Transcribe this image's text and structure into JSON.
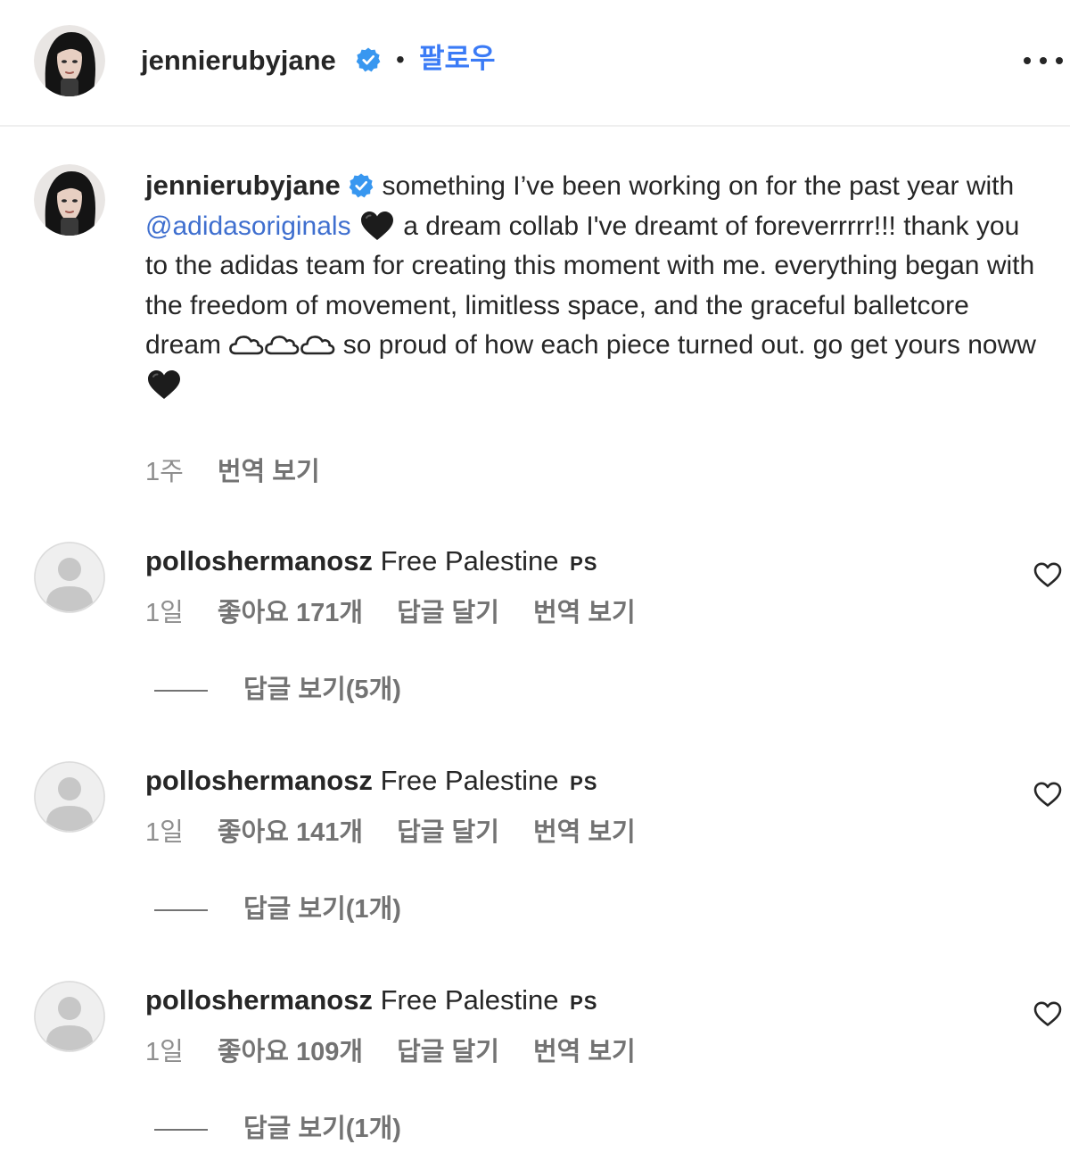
{
  "colors": {
    "accent": "#3b7bf6",
    "text": "#262626",
    "muted": "#8e8e8e",
    "verified": "#3897f0"
  },
  "header": {
    "username": "jennierubyjane",
    "separator": "•",
    "follow_label": "팔로우",
    "more_icon": "more-horizontal-icon"
  },
  "caption": {
    "username": "jennierubyjane",
    "text_1": "something I’ve been working on for the past year with",
    "mention": "@adidasoriginals",
    "text_2": "a dream collab I've dreamt of foreverrrrr!!! thank you to the adidas team for creating this moment with me. everything began with the freedom of movement, limitless space, and the graceful balletcore dream",
    "text_3": "so proud of how each piece turned out. go get yours noww",
    "time": "1주",
    "translate": "번역 보기"
  },
  "comments": [
    {
      "username": "polloshermanosz",
      "text": "Free Palestine",
      "flag": "PS",
      "time": "1일",
      "likes": "좋아요 171개",
      "reply": "답글 달기",
      "translate": "번역 보기",
      "view_replies": "답글 보기(5개)"
    },
    {
      "username": "polloshermanosz",
      "text": "Free Palestine",
      "flag": "PS",
      "time": "1일",
      "likes": "좋아요 141개",
      "reply": "답글 달기",
      "translate": "번역 보기",
      "view_replies": "답글 보기(1개)"
    },
    {
      "username": "polloshermanosz",
      "text": "Free Palestine",
      "flag": "PS",
      "time": "1일",
      "likes": "좋아요 109개",
      "reply": "답글 달기",
      "translate": "번역 보기",
      "view_replies": "답글 보기(1개)"
    }
  ]
}
